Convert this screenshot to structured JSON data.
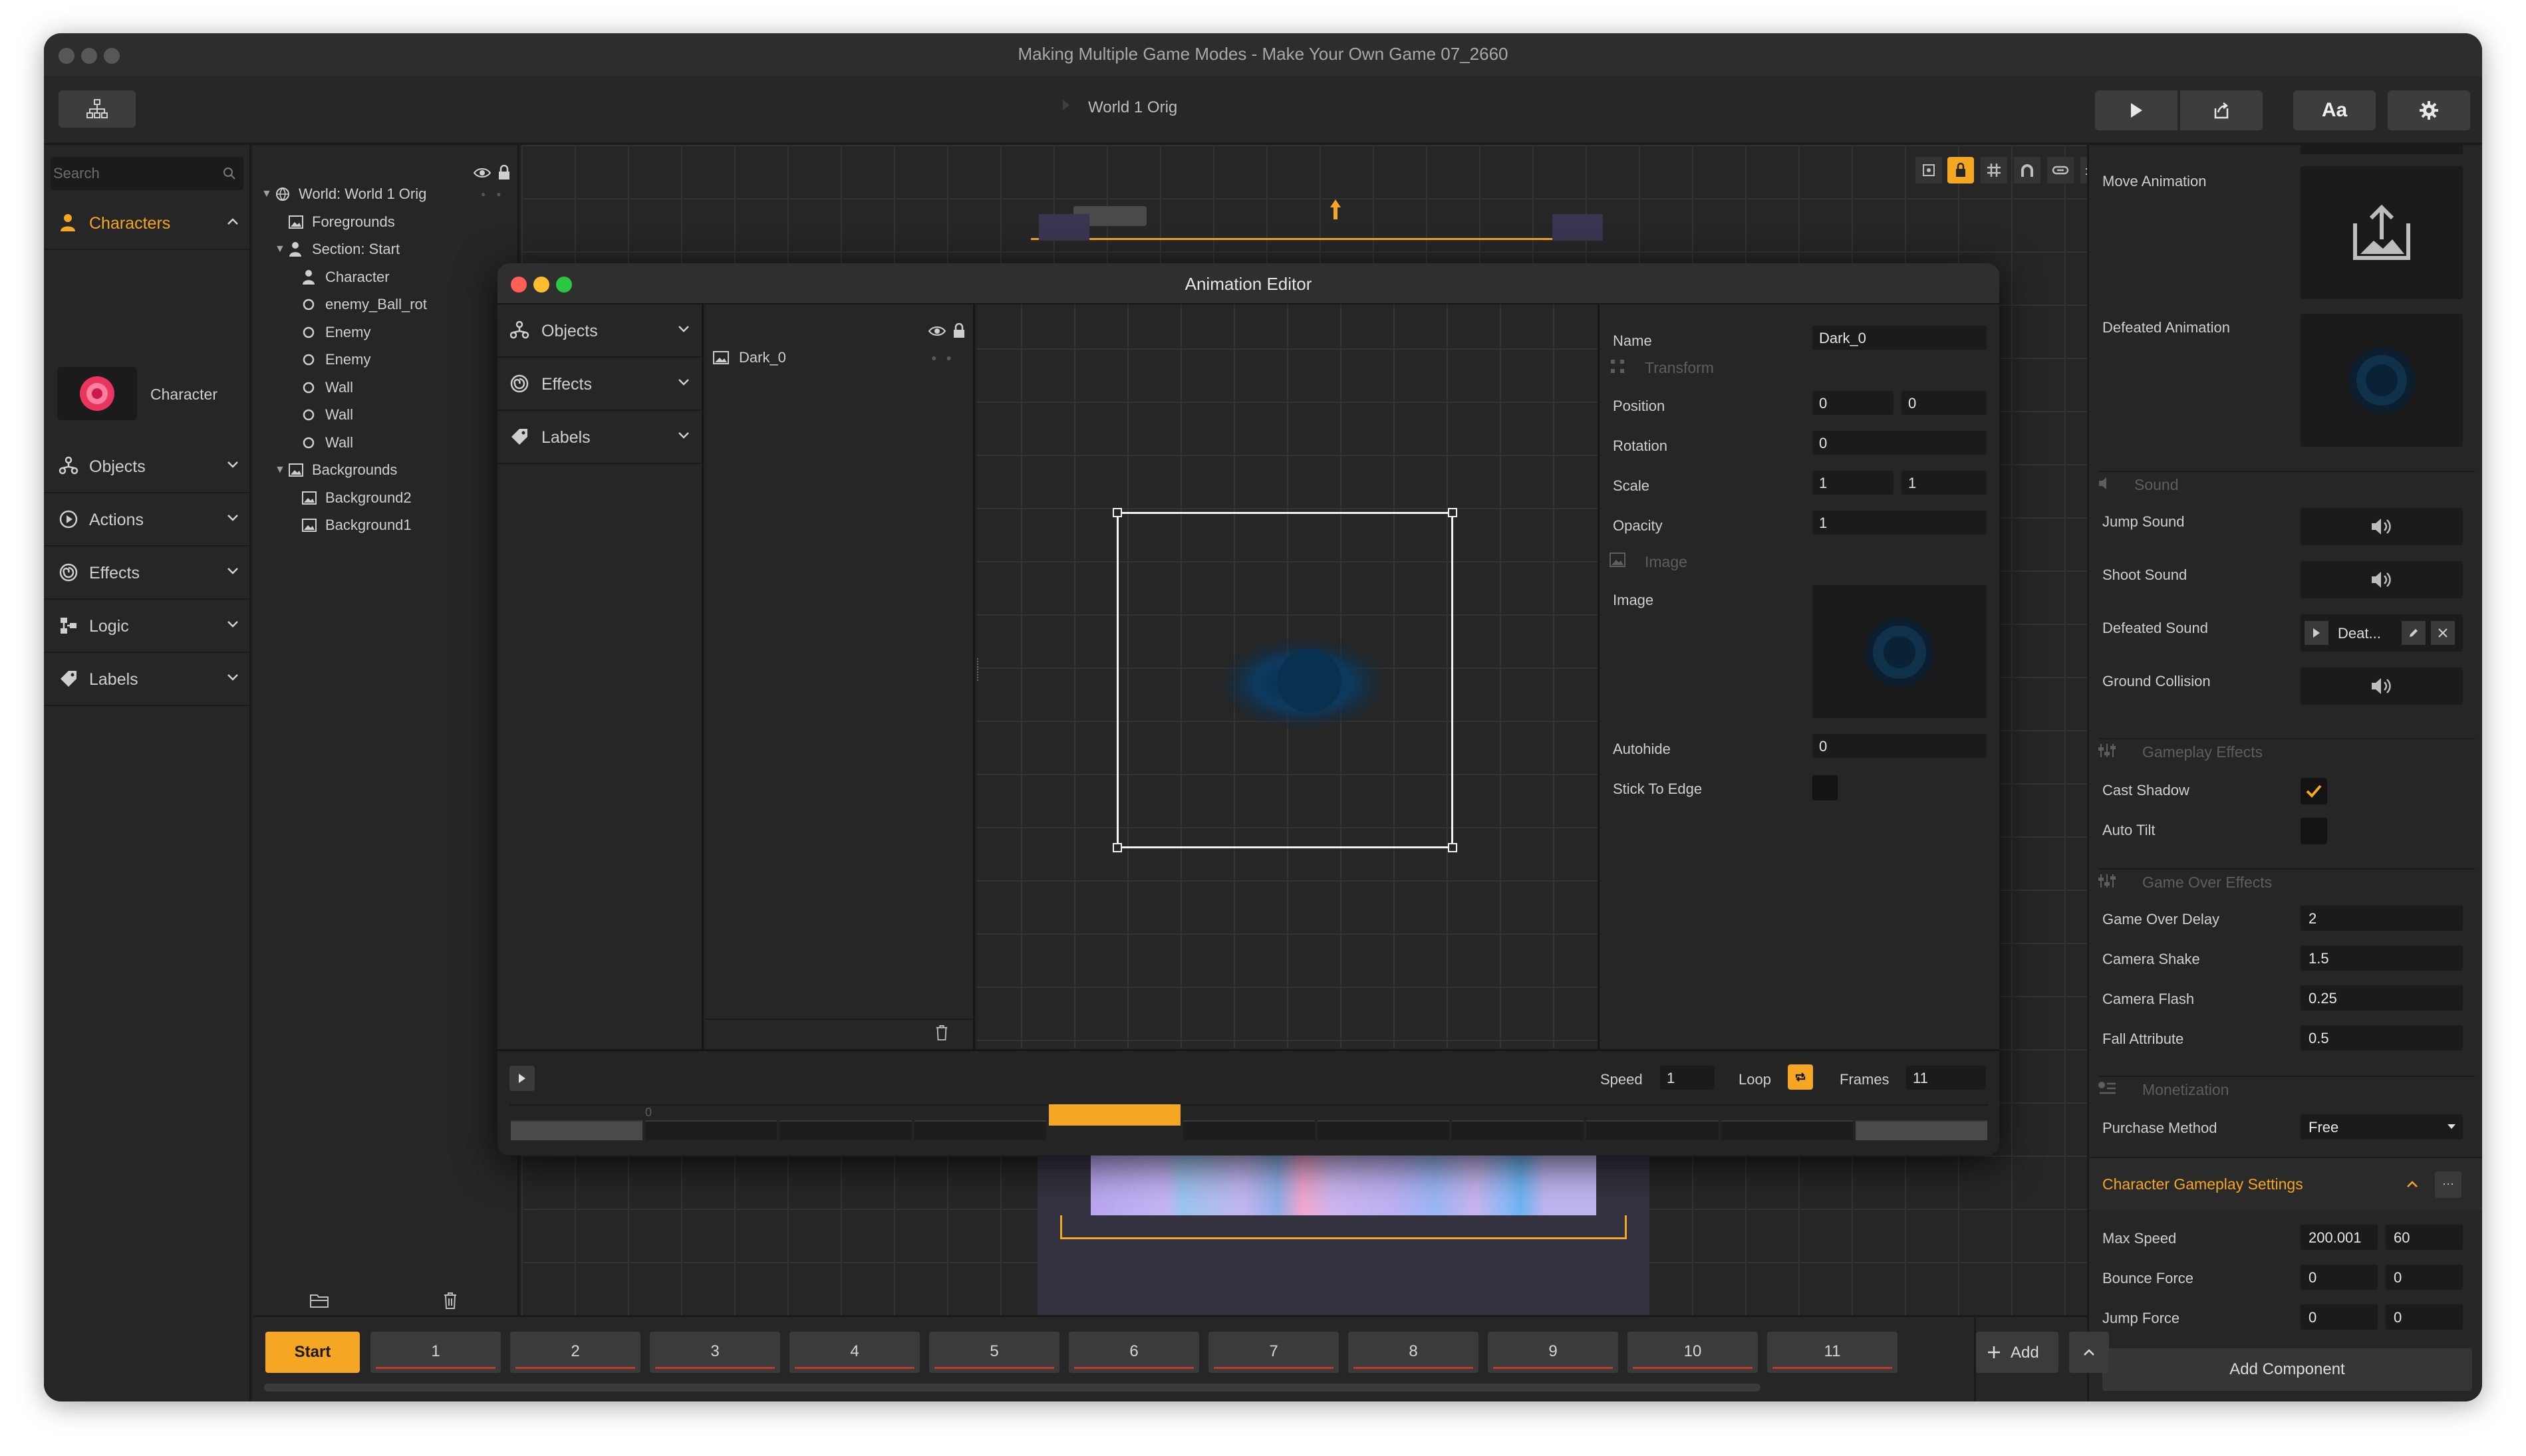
{
  "window": {
    "title": "Making Multiple Game Modes - Make Your Own Game 07_2660",
    "breadcrumb": "World 1 Orig",
    "font_button_label": "Aa"
  },
  "left_panel": {
    "search_placeholder": "Search",
    "categories": [
      {
        "label": "Characters",
        "icon": "person-icon",
        "selected": true
      },
      {
        "label": "Objects",
        "icon": "objects-icon"
      },
      {
        "label": "Actions",
        "icon": "play-circle-icon"
      },
      {
        "label": "Effects",
        "icon": "swirl-icon"
      },
      {
        "label": "Logic",
        "icon": "logic-icon"
      },
      {
        "label": "Labels",
        "icon": "tag-icon"
      }
    ],
    "character_item_label": "Character"
  },
  "tree": {
    "rows": [
      {
        "label": "World: World 1 Orig",
        "indent": 0,
        "icon": "globe-icon",
        "expanded": true
      },
      {
        "label": "Foregrounds",
        "indent": 1,
        "icon": "image-icon"
      },
      {
        "label": "Section: Start",
        "indent": 1,
        "icon": "person-icon",
        "expanded": true
      },
      {
        "label": "Character",
        "indent": 2,
        "icon": "person-icon"
      },
      {
        "label": "enemy_Ball_rot",
        "indent": 2,
        "icon": "circle-icon"
      },
      {
        "label": "Enemy",
        "indent": 2,
        "icon": "circle-icon"
      },
      {
        "label": "Enemy",
        "indent": 2,
        "icon": "circle-icon"
      },
      {
        "label": "Wall",
        "indent": 2,
        "icon": "circle-icon"
      },
      {
        "label": "Wall",
        "indent": 2,
        "icon": "circle-icon"
      },
      {
        "label": "Wall",
        "indent": 2,
        "icon": "circle-icon"
      },
      {
        "label": "Backgrounds",
        "indent": 1,
        "icon": "image-icon",
        "expanded": true
      },
      {
        "label": "Background2",
        "indent": 2,
        "icon": "image-icon"
      },
      {
        "label": "Background1",
        "indent": 2,
        "icon": "image-icon"
      }
    ]
  },
  "right_panel": {
    "move_animation": "Move Animation",
    "defeated_animation": "Defeated Animation",
    "sound_section": "Sound",
    "jump_sound": "Jump Sound",
    "shoot_sound": "Shoot Sound",
    "defeated_sound": "Defeated Sound",
    "defeated_sound_value": "Deat...",
    "ground_collision": "Ground Collision",
    "gameplay_effects_section": "Gameplay Effects",
    "cast_shadow": "Cast Shadow",
    "cast_shadow_checked": true,
    "auto_tilt": "Auto Tilt",
    "auto_tilt_checked": false,
    "game_over_section": "Game Over Effects",
    "game_over_delay": {
      "label": "Game Over Delay",
      "value": "2"
    },
    "camera_shake": {
      "label": "Camera Shake",
      "value": "1.5"
    },
    "camera_flash": {
      "label": "Camera Flash",
      "value": "0.25"
    },
    "fall_attribute": {
      "label": "Fall Attribute",
      "value": "0.5"
    },
    "monetization_section": "Monetization",
    "purchase_method": {
      "label": "Purchase Method",
      "value": "Free"
    },
    "char_settings_title": "Character Gameplay Settings",
    "more_label": "···",
    "max_speed": {
      "label": "Max Speed",
      "v1": "200.001",
      "v2": "60"
    },
    "bounce_force": {
      "label": "Bounce Force",
      "v1": "0",
      "v2": "0"
    },
    "jump_force": {
      "label": "Jump Force",
      "v1": "0",
      "v2": "0"
    },
    "add_component": "Add Component"
  },
  "bottom_bar": {
    "start_label": "Start",
    "sections": [
      "1",
      "2",
      "3",
      "4",
      "5",
      "6",
      "7",
      "8",
      "9",
      "10",
      "11"
    ],
    "add_label": "Add"
  },
  "dialog": {
    "title": "Animation Editor",
    "categories": [
      {
        "label": "Objects",
        "icon": "objects-icon"
      },
      {
        "label": "Effects",
        "icon": "swirl-icon"
      },
      {
        "label": "Labels",
        "icon": "tag-icon"
      }
    ],
    "layer_name": "Dark_0",
    "props": {
      "name": {
        "label": "Name",
        "value": "Dark_0"
      },
      "transform_section": "Transform",
      "position": {
        "label": "Position",
        "x": "0",
        "y": "0"
      },
      "rotation": {
        "label": "Rotation",
        "value": "0"
      },
      "scale": {
        "label": "Scale",
        "x": "1",
        "y": "1"
      },
      "opacity": {
        "label": "Opacity",
        "value": "1"
      },
      "image_section": "Image",
      "image_label": "Image",
      "autohide": {
        "label": "Autohide",
        "value": "0"
      },
      "stick_to_edge": {
        "label": "Stick To Edge",
        "checked": false
      }
    },
    "timeline": {
      "speed_label": "Speed",
      "speed_value": "1",
      "loop_label": "Loop",
      "loop_enabled": true,
      "frames_label": "Frames",
      "frames_value": "11",
      "first_frame_marker": "0",
      "selected_frame": 4
    }
  },
  "colors": {
    "accent": "#f5a623",
    "panel": "#262626",
    "field": "#1b1b1b",
    "section_underline": "#c0392b"
  }
}
